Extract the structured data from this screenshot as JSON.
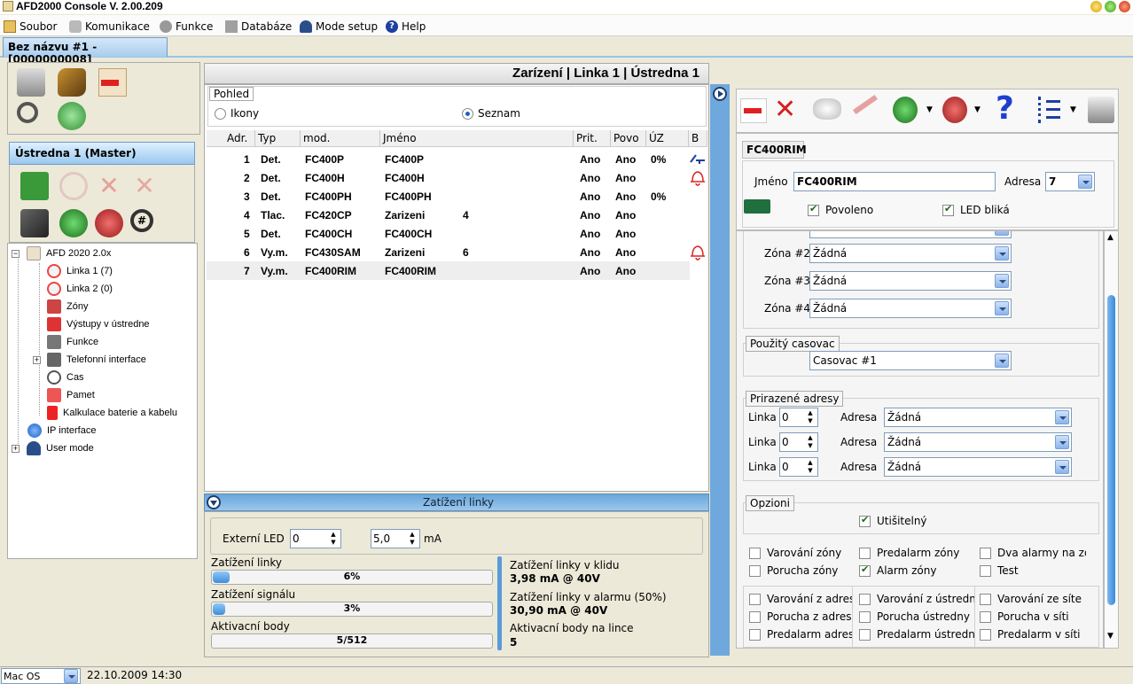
{
  "window": {
    "title": "AFD2000 Console V. 2.00.209"
  },
  "menu": {
    "items": [
      "Soubor",
      "Komunikace",
      "Funkce",
      "Databáze",
      "Mode setup",
      "Help"
    ]
  },
  "tab": {
    "label": "Bez názvu #1 - [0000000008]"
  },
  "master": {
    "title": "Ústredna 1 (Master)"
  },
  "tree": {
    "root": "AFD 2020 2.0x",
    "items": [
      "Linka 1 (7)",
      "Linka 2 (0)",
      "Zóny",
      "Výstupy v ústredne",
      "Funkce",
      "Telefonní interface",
      "Cas",
      "Pamet",
      "Kalkulace baterie a kabelu"
    ],
    "ip": "IP interface",
    "user": "User mode"
  },
  "center": {
    "title": "Zarízení | Linka 1 | Ústredna 1",
    "view_legend": "Pohled",
    "view_icons": "Ikony",
    "view_list": "Seznam",
    "columns": [
      "Adr.",
      "Typ",
      "mod.",
      "Jméno",
      "Prit.",
      "Povo",
      "ÚZ",
      "B"
    ],
    "rows": [
      {
        "adr": "1",
        "typ": "Det.",
        "mod": "FC400P",
        "name": "FC400P",
        "num": "",
        "prit": "Ano",
        "povo": "Ano",
        "uz": "0%"
      },
      {
        "adr": "2",
        "typ": "Det.",
        "mod": "FC400H",
        "name": "FC400H",
        "num": "",
        "prit": "Ano",
        "povo": "Ano",
        "uz": ""
      },
      {
        "adr": "3",
        "typ": "Det.",
        "mod": "FC400PH",
        "name": "FC400PH",
        "num": "",
        "prit": "Ano",
        "povo": "Ano",
        "uz": "0%"
      },
      {
        "adr": "4",
        "typ": "Tlac.",
        "mod": "FC420CP",
        "name": "Zarizeni",
        "num": "4",
        "prit": "Ano",
        "povo": "Ano",
        "uz": ""
      },
      {
        "adr": "5",
        "typ": "Det.",
        "mod": "FC400CH",
        "name": "FC400CH",
        "num": "",
        "prit": "Ano",
        "povo": "Ano",
        "uz": ""
      },
      {
        "adr": "6",
        "typ": "Vy.m.",
        "mod": "FC430SAM",
        "name": "Zarizeni",
        "num": "6",
        "prit": "Ano",
        "povo": "Ano",
        "uz": ""
      },
      {
        "adr": "7",
        "typ": "Vy.m.",
        "mod": "FC400RIM",
        "name": "FC400RIM",
        "num": "",
        "prit": "Ano",
        "povo": "Ano",
        "uz": ""
      }
    ]
  },
  "load": {
    "title": "Zatížení linky",
    "ext_led_label": "Externí LED",
    "ext_led_value": "0",
    "ma_value": "5,0",
    "ma_unit": "mA",
    "line_load_label": "Zatížení linky",
    "line_load_value": "6%",
    "line_load_fraction": 0.06,
    "signal_load_label": "Zatížení signálu",
    "signal_load_value": "3%",
    "signal_load_fraction": 0.03,
    "activation_label": "Aktivacní body",
    "activation_value": "5/512",
    "activation_fraction": 0.01,
    "idle_label": "Zatížení linky v klidu",
    "idle_value": "3,98 mA @ 40V",
    "alarm_label": "Zatížení linky v alarmu (50%)",
    "alarm_value": "30,90 mA @ 40V",
    "points_label": "Aktivacní body na lince",
    "points_value": "5"
  },
  "device": {
    "title": "FC400RIM",
    "name_label": "Jméno",
    "name_value": "FC400RIM",
    "addr_label": "Adresa",
    "addr_value": "7",
    "enabled_label": "Povoleno",
    "led_label": "LED bliká"
  },
  "zones": [
    {
      "label": "Zóna #2",
      "value": "Žádná"
    },
    {
      "label": "Zóna #3",
      "value": "Žádná"
    },
    {
      "label": "Zóna #4",
      "value": "Žádná"
    }
  ],
  "timer": {
    "legend": "Použitý casovac",
    "value": "Casovac #1"
  },
  "assigned": {
    "legend": "Prirazené adresy",
    "rows": [
      {
        "linka_label": "Linka",
        "linka": "0",
        "adresa_label": "Adresa",
        "adresa": "Žádná"
      },
      {
        "linka_label": "Linka",
        "linka": "0",
        "adresa_label": "Adresa",
        "adresa": "Žádná"
      },
      {
        "linka_label": "Linka",
        "linka": "0",
        "adresa_label": "Adresa",
        "adresa": "Žádná"
      }
    ]
  },
  "options": {
    "legend": "Opzioni",
    "silent": "Utišitelný",
    "row1": [
      "Varování zóny",
      "Predalarm zóny",
      "Dva alarmy na zó"
    ],
    "row2": [
      "Porucha zóny",
      "Alarm zóny",
      "Test"
    ],
    "row3": [
      "Varování z adres",
      "Varování z ústredn",
      "Varování ze síte"
    ],
    "row4": [
      "Porucha z adres",
      "Porucha ústredny",
      "Porucha v síti"
    ],
    "row5": [
      "Predalarm adres",
      "Predalarm ústredny",
      "Predalarm v síti"
    ]
  },
  "status": {
    "os": "Mac OS",
    "datetime": "22.10.2009 14:30"
  }
}
